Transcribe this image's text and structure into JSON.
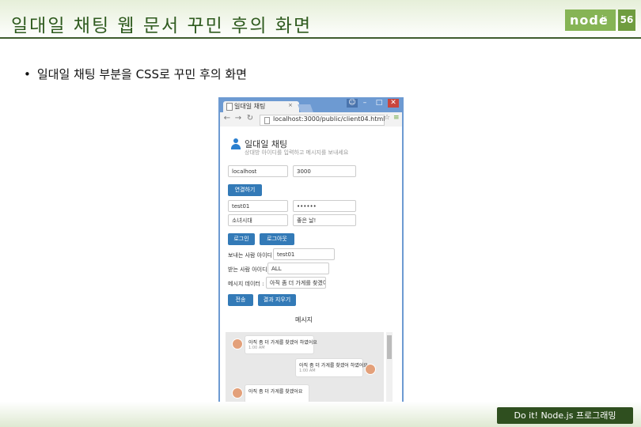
{
  "slide": {
    "title": "일대일 채팅 웹 문서 꾸민 후의 화면",
    "logo_text": "node",
    "logo_suffix": "js",
    "page_number": "56",
    "bullet": "일대일 채팅 부분을 CSS로 꾸민 후의 화면",
    "footer": "Do it! Node.js 프로그래밍"
  },
  "browser": {
    "tab_title": "일대일 채팅",
    "tab_close": "×",
    "url": "localhost:3000/public/client04.html",
    "window_controls": {
      "minimize": "–",
      "maximize": "□",
      "close": "✕"
    }
  },
  "app": {
    "title": "일대일 채팅",
    "subtitle": "상대방 아이디를 입력하고 메시지를 보내세요",
    "host_value": "localhost",
    "port_value": "3000",
    "connect_label": "연결하기",
    "id_value": "test01",
    "password_value": "••••••",
    "alias_value": "소녀시대",
    "status_value": "좋은 날!",
    "login_label": "로그인",
    "logout_label": "로그아웃",
    "sender_label": "보내는 사람 아이디 :",
    "sender_value": "test01",
    "receiver_label": "받는 사람 아이디 :",
    "receiver_value": "ALL",
    "message_label": "메시지 데이터 :",
    "message_value": "아직 좀 더 가게를 찾겠어",
    "send_label": "전송",
    "clear_label": "결과 지우기",
    "messages_title": "메시지",
    "messages": [
      {
        "text": "아직 좀 더 가게를 찾겠어 하였어요",
        "time": "1:00 AM",
        "side": "left"
      },
      {
        "text": "아직 좀 더 가게를 찾겠어 하였어요",
        "time": "1:00 AM",
        "side": "right"
      },
      {
        "text": "아직 좀 더 가게를 찾겠어요",
        "time": "",
        "side": "left"
      }
    ]
  },
  "colors": {
    "title_green": "#2f5b1f",
    "logo_green": "#86b455",
    "footer_dark": "#2f4f1f",
    "button_blue": "#337ab7",
    "browser_frame": "#6d9ad2"
  }
}
